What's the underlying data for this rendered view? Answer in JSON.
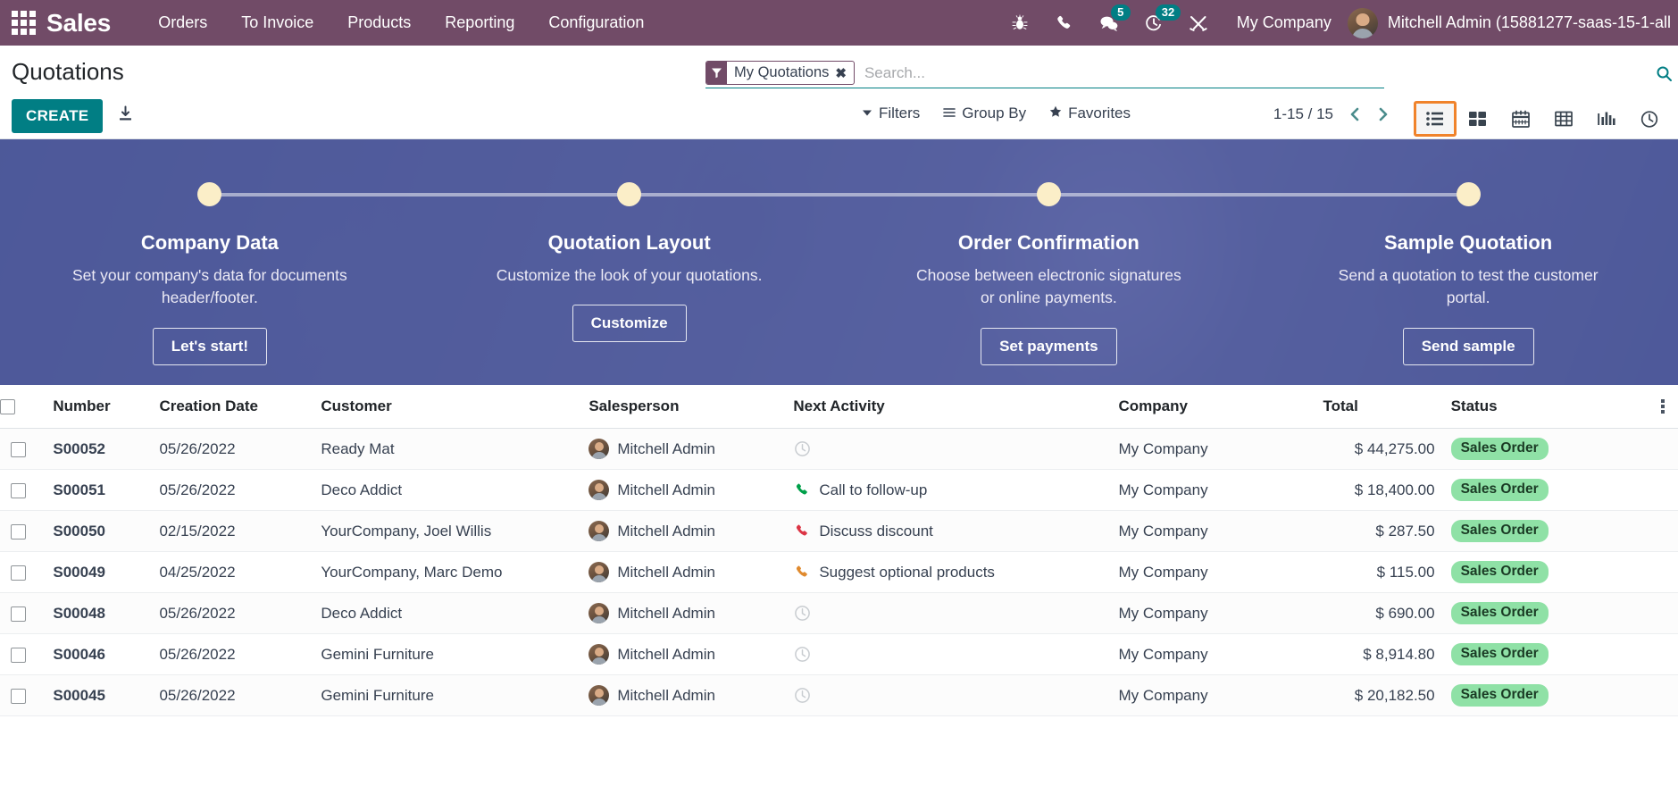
{
  "navbar": {
    "apps_icon": "apps-grid-icon",
    "brand": "Sales",
    "menu": [
      {
        "label": "Orders"
      },
      {
        "label": "To Invoice"
      },
      {
        "label": "Products"
      },
      {
        "label": "Reporting"
      },
      {
        "label": "Configuration"
      }
    ],
    "icons": [
      {
        "name": "bug-icon",
        "badge": null
      },
      {
        "name": "phone-icon",
        "badge": null
      },
      {
        "name": "messages-icon",
        "badge": "5"
      },
      {
        "name": "activities-clock-icon",
        "badge": "32"
      },
      {
        "name": "developer-tools-icon",
        "badge": null
      }
    ],
    "company": "My Company",
    "user": "Mitchell Admin (15881277-saas-15-1-all",
    "bg_color": "#714B67",
    "badge_color": "#017e84"
  },
  "control_panel": {
    "title": "Quotations",
    "create_label": "CREATE",
    "download_icon": "download-icon",
    "search": {
      "facet_label": "My Quotations",
      "facet_icon": "filter-icon",
      "facet_remove": "✖",
      "placeholder": "Search...",
      "value": ""
    },
    "buttons": [
      {
        "label": "Filters",
        "icon": "caret-down-icon"
      },
      {
        "label": "Group By",
        "icon": "list-lines-icon"
      },
      {
        "label": "Favorites",
        "icon": "star-icon"
      }
    ],
    "pager": "1-15 / 15",
    "prev_icon": "chevron-left-icon",
    "next_icon": "chevron-right-icon",
    "views": [
      {
        "name": "list-view",
        "icon": "list-icon",
        "active": true
      },
      {
        "name": "kanban-view",
        "icon": "kanban-icon",
        "active": false
      },
      {
        "name": "calendar-view",
        "icon": "calendar-icon",
        "active": false
      },
      {
        "name": "pivot-view",
        "icon": "pivot-table-icon",
        "active": false
      },
      {
        "name": "graph-view",
        "icon": "bar-chart-icon",
        "active": false
      },
      {
        "name": "activity-view",
        "icon": "clock-icon",
        "active": false
      }
    ],
    "active_view_outline": "#f0832b"
  },
  "banner": {
    "steps": [
      {
        "title": "Company Data",
        "desc": "Set your company's data for documents header/footer.",
        "button": "Let's start!"
      },
      {
        "title": "Quotation Layout",
        "desc": "Customize the look of your quotations.",
        "button": "Customize"
      },
      {
        "title": "Order Confirmation",
        "desc": "Choose between electronic signatures or online payments.",
        "button": "Set payments"
      },
      {
        "title": "Sample Quotation",
        "desc": "Send a quotation to test the customer portal.",
        "button": "Send sample"
      }
    ],
    "overlay_color": "#4a5aac",
    "dot_color": "#fbeec8"
  },
  "list": {
    "columns": [
      "Number",
      "Creation Date",
      "Customer",
      "Salesperson",
      "Next Activity",
      "Company",
      "Total",
      "Status"
    ],
    "rows": [
      {
        "number": "S00052",
        "date": "05/26/2022",
        "customer": "Ready Mat",
        "salesperson": "Mitchell Admin",
        "activity": "",
        "activity_icon": "clock-icon",
        "activity_color": "#c8ccd0",
        "company": "My Company",
        "total": "$ 44,275.00",
        "status": "Sales Order"
      },
      {
        "number": "S00051",
        "date": "05/26/2022",
        "customer": "Deco Addict",
        "salesperson": "Mitchell Admin",
        "activity": "Call to follow-up",
        "activity_icon": "phone-icon",
        "activity_color": "#00a04a",
        "company": "My Company",
        "total": "$ 18,400.00",
        "status": "Sales Order"
      },
      {
        "number": "S00050",
        "date": "02/15/2022",
        "customer": "YourCompany, Joel Willis",
        "salesperson": "Mitchell Admin",
        "activity": "Discuss discount",
        "activity_icon": "phone-icon",
        "activity_color": "#dc3545",
        "company": "My Company",
        "total": "$ 287.50",
        "status": "Sales Order"
      },
      {
        "number": "S00049",
        "date": "04/25/2022",
        "customer": "YourCompany, Marc Demo",
        "salesperson": "Mitchell Admin",
        "activity": "Suggest optional products",
        "activity_icon": "phone-icon",
        "activity_color": "#e08a2e",
        "company": "My Company",
        "total": "$ 115.00",
        "status": "Sales Order"
      },
      {
        "number": "S00048",
        "date": "05/26/2022",
        "customer": "Deco Addict",
        "salesperson": "Mitchell Admin",
        "activity": "",
        "activity_icon": "clock-icon",
        "activity_color": "#c8ccd0",
        "company": "My Company",
        "total": "$ 690.00",
        "status": "Sales Order"
      },
      {
        "number": "S00046",
        "date": "05/26/2022",
        "customer": "Gemini Furniture",
        "salesperson": "Mitchell Admin",
        "activity": "",
        "activity_icon": "clock-icon",
        "activity_color": "#c8ccd0",
        "company": "My Company",
        "total": "$ 8,914.80",
        "status": "Sales Order"
      },
      {
        "number": "S00045",
        "date": "05/26/2022",
        "customer": "Gemini Furniture",
        "salesperson": "Mitchell Admin",
        "activity": "",
        "activity_icon": "clock-icon",
        "activity_color": "#c8ccd0",
        "company": "My Company",
        "total": "$ 20,182.50",
        "status": "Sales Order"
      }
    ],
    "status_badge_color": "#8fe1a6",
    "options_icon": "vertical-dots-icon"
  }
}
